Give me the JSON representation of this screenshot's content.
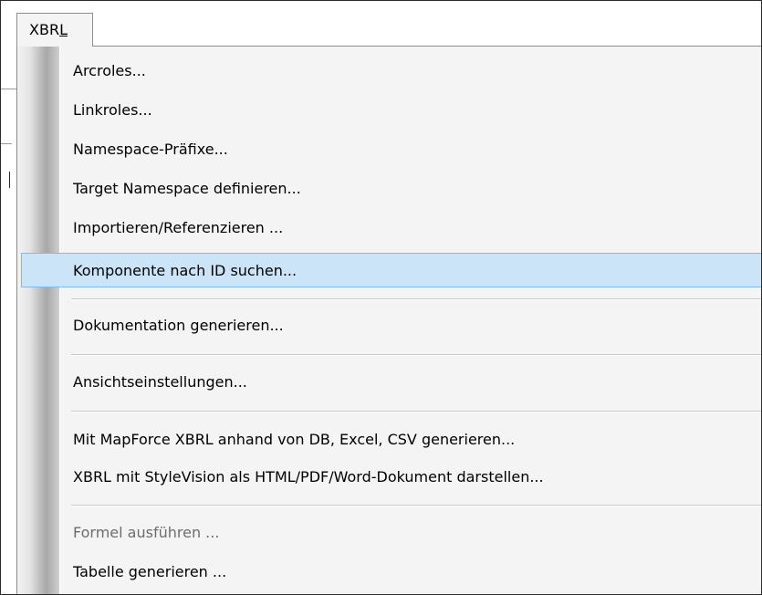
{
  "menubar": {
    "title_prefix": "XBR",
    "title_underlined": "L"
  },
  "menu": {
    "items": [
      {
        "label": "Arcroles..."
      },
      {
        "label": "Linkroles..."
      },
      {
        "label": "Namespace-Präfixe..."
      },
      {
        "label": "Target Namespace definieren..."
      },
      {
        "label": "Importieren/Referenzieren ..."
      },
      {
        "label": "Komponente nach ID suchen...",
        "state": "highlighted"
      },
      {
        "label": "Dokumentation generieren..."
      },
      {
        "label": "Ansichtseinstellungen..."
      },
      {
        "label": "Mit MapForce XBRL anhand von DB, Excel, CSV generieren..."
      },
      {
        "label": "XBRL mit StyleVision als HTML/PDF/Word-Dokument darstellen..."
      },
      {
        "label": "Formel ausführen ...",
        "state": "disabled"
      },
      {
        "label": "Tabelle generieren ..."
      }
    ]
  },
  "colors": {
    "highlight_bg": "#cce4f7",
    "highlight_border": "#84b8e6",
    "menu_bg": "#f4f4f4",
    "disabled_text": "#6d6d6d"
  }
}
